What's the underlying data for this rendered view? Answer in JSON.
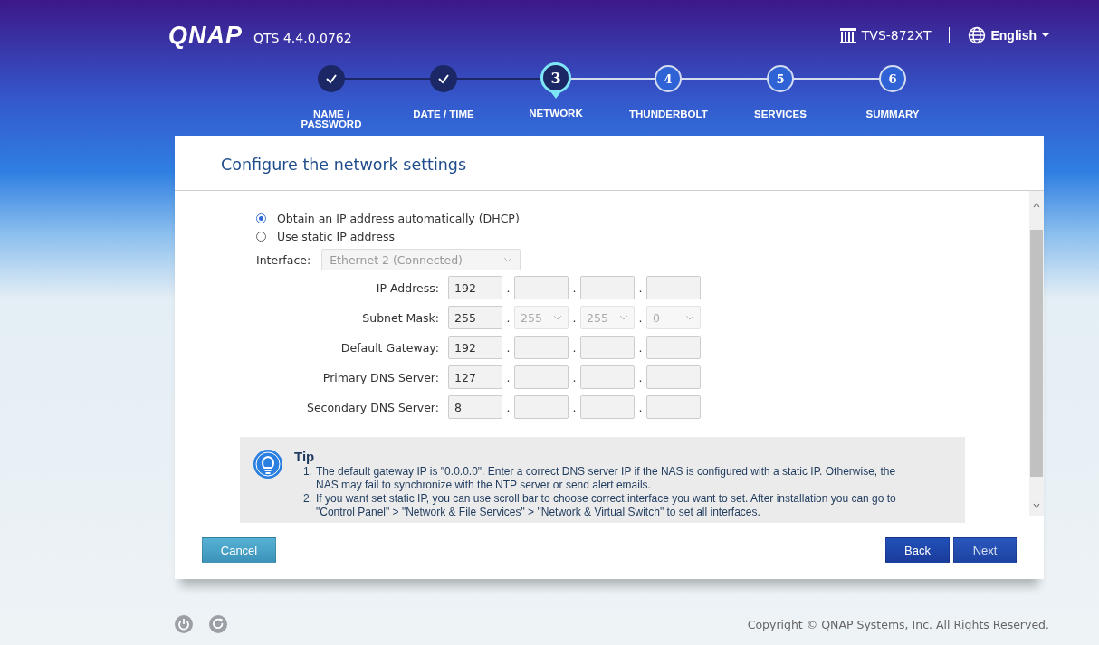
{
  "header": {
    "logo": "QNAP",
    "version": "QTS 4.4.0.0762",
    "model": "TVS-872XT",
    "language": "English"
  },
  "steps": [
    {
      "label": "NAME / PASSWORD",
      "completed": true,
      "selected": false
    },
    {
      "label": "DATE / TIME",
      "completed": true,
      "selected": false
    },
    {
      "number": "3",
      "label": "NETWORK",
      "completed": false,
      "selected": true
    },
    {
      "number": "4",
      "label": "THUNDERBOLT",
      "completed": false,
      "selected": false
    },
    {
      "number": "5",
      "label": "SERVICES",
      "completed": false,
      "selected": false
    },
    {
      "number": "6",
      "label": "SUMMARY",
      "completed": false,
      "selected": false
    }
  ],
  "panel": {
    "title": "Configure the network settings",
    "ip_mode": [
      {
        "label": "Obtain an IP address automatically (DHCP)",
        "selected": true
      },
      {
        "label": "Use static IP address",
        "selected": false
      }
    ],
    "interface": {
      "label": "Interface:",
      "value": "Ethernet 2 (Connected)",
      "disabled": true
    },
    "address_rows": [
      {
        "label": "IP Address:",
        "octets": [
          {
            "kind": "input",
            "value": "192"
          },
          {
            "kind": "input"
          },
          {
            "kind": "input"
          },
          {
            "kind": "input"
          }
        ]
      },
      {
        "label": "Subnet Mask:",
        "octets": [
          {
            "kind": "input",
            "value": "255"
          },
          {
            "kind": "select",
            "value": "255"
          },
          {
            "kind": "select",
            "value": "255"
          },
          {
            "kind": "select",
            "value": "0"
          }
        ]
      },
      {
        "label": "Default Gateway:",
        "octets": [
          {
            "kind": "input",
            "value": "192"
          },
          {
            "kind": "input"
          },
          {
            "kind": "input"
          },
          {
            "kind": "input"
          }
        ]
      },
      {
        "label": "Primary DNS Server:",
        "octets": [
          {
            "kind": "input",
            "value": "127"
          },
          {
            "kind": "input"
          },
          {
            "kind": "input"
          },
          {
            "kind": "input"
          }
        ]
      },
      {
        "label": "Secondary DNS Server:",
        "octets": [
          {
            "kind": "input",
            "value": "8"
          },
          {
            "kind": "input"
          },
          {
            "kind": "input"
          },
          {
            "kind": "input"
          }
        ]
      }
    ],
    "separator": ".",
    "tip": {
      "title": "Tip",
      "items": [
        {
          "marker": "1.",
          "text": "The default gateway IP is \"0.0.0.0\". Enter a correct DNS server IP if the NAS is configured with a static IP. Otherwise, the NAS may fail to synchronize with the NTP server or send alert emails."
        },
        {
          "marker": "2.",
          "text": "If you want set static IP, you can use scroll bar to choose correct interface you want to set. After installation you can go to \"Control Panel\" > \"Network & File Services\" > \"Network & Virtual Switch\" to set all interfaces."
        }
      ]
    },
    "buttons": {
      "cancel": "Cancel",
      "back": "Back",
      "next": "Next"
    }
  },
  "footer": {
    "copyright": "Copyright © QNAP Systems, Inc. All Rights Reserved."
  }
}
